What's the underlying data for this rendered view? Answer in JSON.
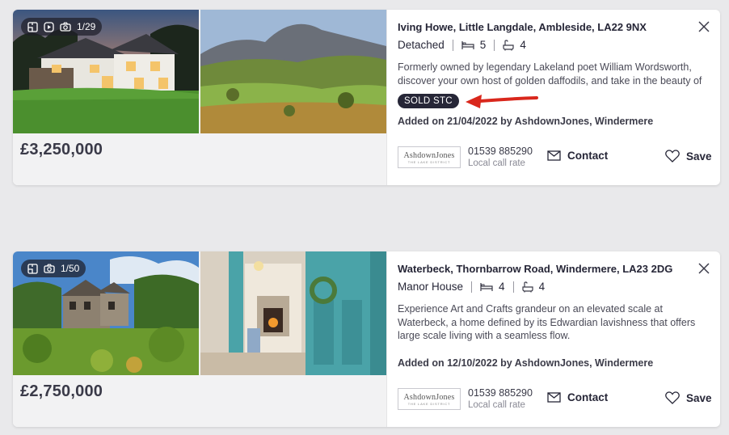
{
  "listings": [
    {
      "media": {
        "counter": "1/29"
      },
      "price": "£3,250,000",
      "address": "Iving Howe, Little Langdale, Ambleside, LA22 9NX",
      "property_type": "Detached",
      "bedrooms": "5",
      "bathrooms": "4",
      "description": "Formerly owned by legendary Lakeland poet William Wordsworth, discover your own host of golden daffodils, and take in the beauty of",
      "status_badge": "SOLD STC",
      "added": "Added on 21/04/2022 by AshdownJones, Windermere",
      "agent_logo": "AshdownJones",
      "agent_logo_tagline": "THE LAKE DISTRICT",
      "phone": "01539 885290",
      "call_rate": "Local call rate",
      "contact_label": "Contact",
      "save_label": "Save"
    },
    {
      "media": {
        "counter": "1/50"
      },
      "price": "£2,750,000",
      "address": "Waterbeck, Thornbarrow Road, Windermere, LA23 2DG",
      "property_type": "Manor House",
      "bedrooms": "4",
      "bathrooms": "4",
      "description": "Experience Art and Crafts grandeur on an elevated scale at Waterbeck, a home defined by its Edwardian lavishness that offers large scale living with a seamless flow.",
      "added": "Added on 12/10/2022 by AshdownJones, Windermere",
      "agent_logo": "AshdownJones",
      "agent_logo_tagline": "THE LAKE DISTRICT",
      "phone": "01539 885290",
      "call_rate": "Local call rate",
      "contact_label": "Contact",
      "save_label": "Save"
    }
  ],
  "icons": {
    "floorplan": "floorplan-icon",
    "video": "video-icon",
    "camera": "camera-icon",
    "bed": "bed-icon",
    "bath": "bath-icon",
    "close": "close-icon",
    "mail": "mail-icon",
    "heart": "heart-icon"
  },
  "colors": {
    "badge_bg": "#262637",
    "annotation_arrow": "#d9271c",
    "text": "#262637"
  }
}
